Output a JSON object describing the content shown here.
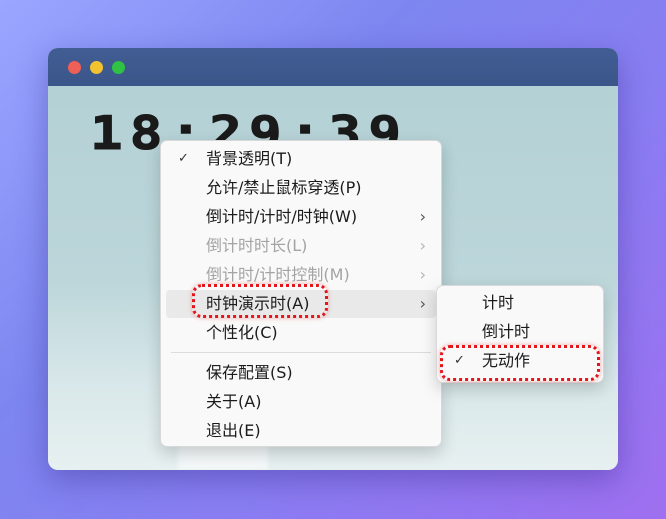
{
  "window": {
    "clock_text": "18:29:39"
  },
  "main_menu": {
    "items": [
      {
        "label": "背景透明(T)",
        "checked": true,
        "has_submenu": false,
        "enabled": true
      },
      {
        "label": "允许/禁止鼠标穿透(P)",
        "checked": false,
        "has_submenu": false,
        "enabled": true
      },
      {
        "label": "倒计时/计时/时钟(W)",
        "checked": false,
        "has_submenu": true,
        "enabled": true
      },
      {
        "label": "倒计时时长(L)",
        "checked": false,
        "has_submenu": true,
        "enabled": false
      },
      {
        "label": "倒计时/计时控制(M)",
        "checked": false,
        "has_submenu": true,
        "enabled": false
      },
      {
        "label": "时钟演示时(A)",
        "checked": false,
        "has_submenu": true,
        "enabled": true,
        "highlighted": true
      },
      {
        "label": "个性化(C)",
        "checked": false,
        "has_submenu": false,
        "enabled": true
      },
      {
        "label": "保存配置(S)",
        "checked": false,
        "has_submenu": false,
        "enabled": true
      },
      {
        "label": "关于(A)",
        "checked": false,
        "has_submenu": false,
        "enabled": true
      },
      {
        "label": "退出(E)",
        "checked": false,
        "has_submenu": false,
        "enabled": true
      }
    ]
  },
  "sub_menu": {
    "items": [
      {
        "label": "计时",
        "checked": false
      },
      {
        "label": "倒计时",
        "checked": false
      },
      {
        "label": "无动作",
        "checked": true
      }
    ]
  },
  "glyphs": {
    "check": "✓",
    "arrow": "›"
  },
  "colors": {
    "titlebar": "#3a5689",
    "highlight_outline": "#e4161b",
    "disabled_text": "#a4a4a4"
  }
}
